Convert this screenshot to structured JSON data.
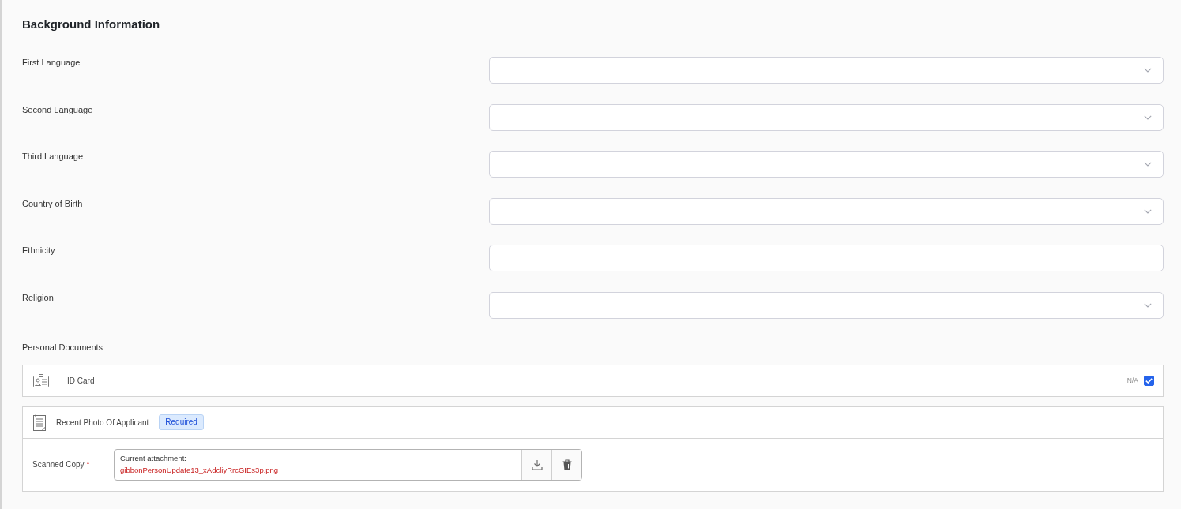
{
  "section": {
    "title": "Background Information"
  },
  "fields": [
    {
      "label": "First Language",
      "kind": "select"
    },
    {
      "label": "Second Language",
      "kind": "select"
    },
    {
      "label": "Third Language",
      "kind": "select"
    },
    {
      "label": "Country of Birth",
      "kind": "select"
    },
    {
      "label": "Ethnicity",
      "kind": "text"
    },
    {
      "label": "Religion",
      "kind": "select"
    }
  ],
  "documents": {
    "title": "Personal Documents",
    "items": [
      {
        "name": "ID Card",
        "kind": "na-toggle",
        "na": {
          "label": "N/A",
          "checked": true
        }
      },
      {
        "name": "Recent Photo Of Applicant",
        "kind": "upload",
        "badge": "Required",
        "upload": {
          "label": "Scanned Copy",
          "required_mark": "*",
          "caption": "Current attachment:",
          "file_name": "gibbonPersonUpdate13_xAdcliyRrcGIEs3p.png"
        }
      }
    ]
  }
}
